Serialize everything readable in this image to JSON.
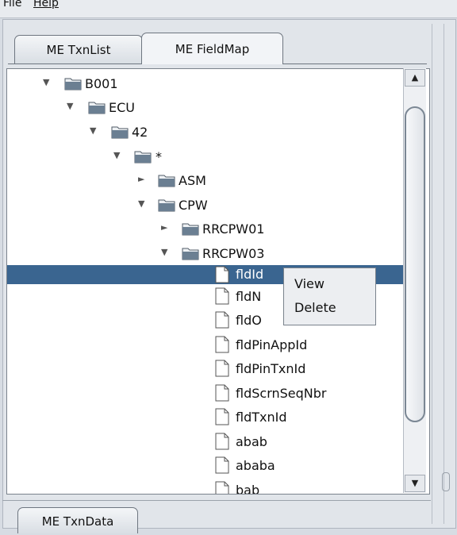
{
  "menubar": {
    "file": "File",
    "help": "Help"
  },
  "tabs": {
    "txnlist": "ME TxnList",
    "fieldmap": "ME FieldMap"
  },
  "tree": {
    "b001": "B001",
    "ecu": "ECU",
    "n42": "42",
    "star": "*",
    "asm": "ASM",
    "cpw": "CPW",
    "rrcpw01": "RRCPW01",
    "rrcpw03": "RRCPW03",
    "leaves": [
      "fldId",
      "fldN",
      "fldO",
      "fldPinAppId",
      "fldPinTxnId",
      "fldScrnSeqNbr",
      "fldTxnId",
      "abab",
      "ababa",
      "bab"
    ]
  },
  "context_menu": {
    "view": "View",
    "delete": "Delete"
  },
  "bottom_tabs": {
    "txndata": "ME TxnData"
  },
  "icons": {
    "expanded": "triangle-down-icon",
    "collapsed": "triangle-right-icon",
    "folder": "folder-icon",
    "document": "document-icon"
  },
  "colors": {
    "selection": "#3a6590"
  }
}
